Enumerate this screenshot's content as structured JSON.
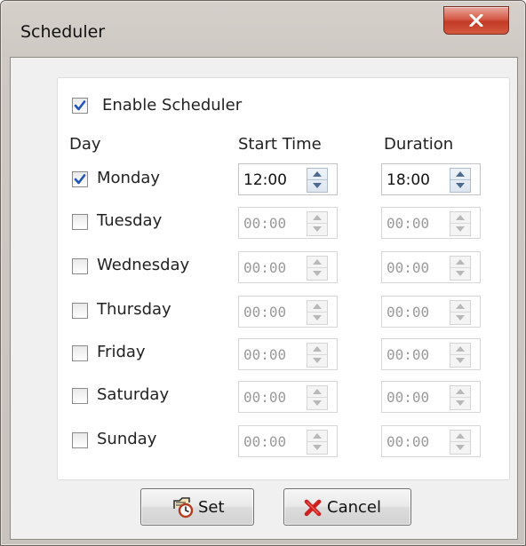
{
  "window": {
    "title": "Scheduler",
    "close_glyph": "x"
  },
  "enable": {
    "label": "Enable Scheduler",
    "checked": true
  },
  "headers": {
    "day": "Day",
    "start": "Start Time",
    "duration": "Duration"
  },
  "days": [
    {
      "label": "Monday",
      "checked": true,
      "start": "12:00",
      "duration": "18:00"
    },
    {
      "label": "Tuesday",
      "checked": false,
      "start": "00:00",
      "duration": "00:00"
    },
    {
      "label": "Wednesday",
      "checked": false,
      "start": "00:00",
      "duration": "00:00"
    },
    {
      "label": "Thursday",
      "checked": false,
      "start": "00:00",
      "duration": "00:00"
    },
    {
      "label": "Friday",
      "checked": false,
      "start": "00:00",
      "duration": "00:00"
    },
    {
      "label": "Saturday",
      "checked": false,
      "start": "00:00",
      "duration": "00:00"
    },
    {
      "label": "Sunday",
      "checked": false,
      "start": "00:00",
      "duration": "00:00"
    }
  ],
  "buttons": {
    "set": {
      "label": "Set",
      "icon": "clock-schedule-icon"
    },
    "cancel": {
      "label": "Cancel",
      "icon": "red-x-icon"
    }
  },
  "colors": {
    "checkmark": "#1f56b8",
    "close_button": "#c9412c",
    "cancel_x": "#d01f1f"
  }
}
